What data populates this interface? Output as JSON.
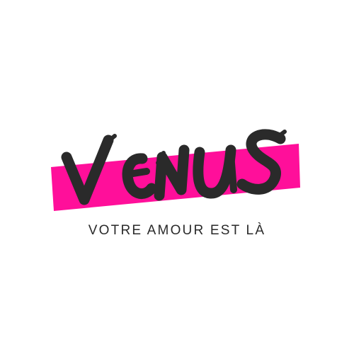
{
  "brand": {
    "wordmark": "VENUS",
    "tagline": "VOTRE AMOUR EST LÀ",
    "colors": {
      "accent": "#ff0f9a",
      "ink": "#2a2a2a",
      "background": "#ffffff"
    }
  }
}
